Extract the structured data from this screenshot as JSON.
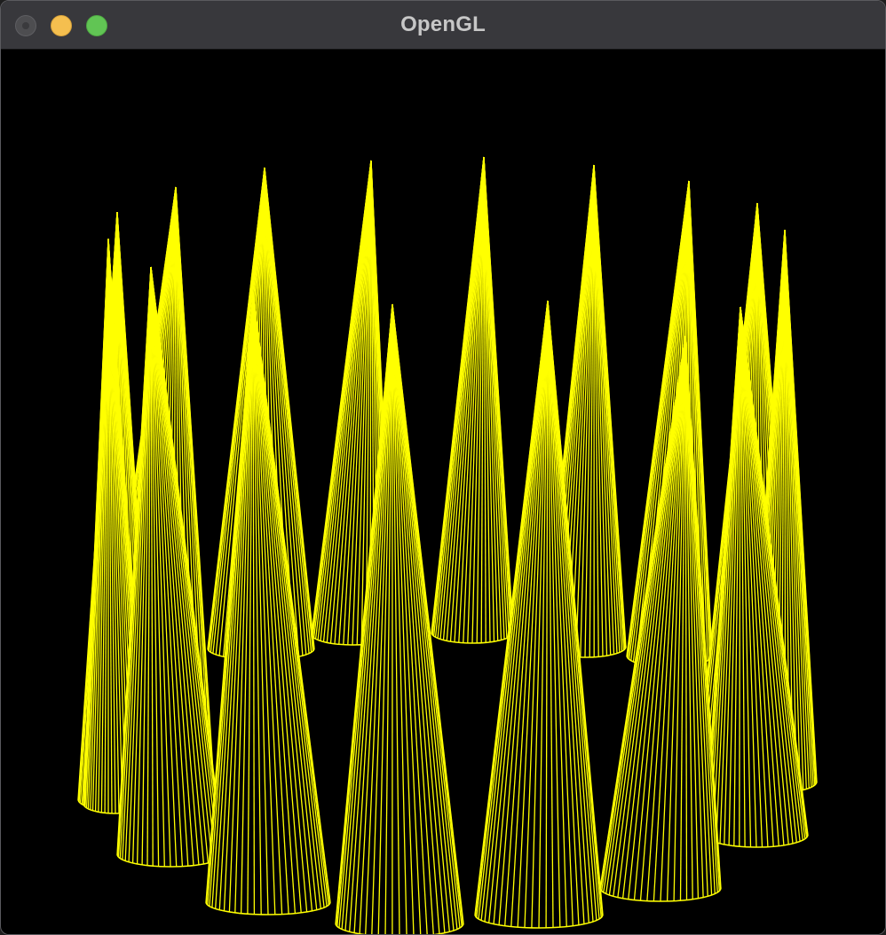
{
  "window": {
    "title": "OpenGL",
    "controls": [
      "close",
      "minimize",
      "zoom"
    ]
  },
  "scene": {
    "background": "#000000",
    "wire_color": "#ffff00",
    "render_mode": "wireframe",
    "object": "cone",
    "object_count": 12,
    "arrangement": "ring"
  }
}
